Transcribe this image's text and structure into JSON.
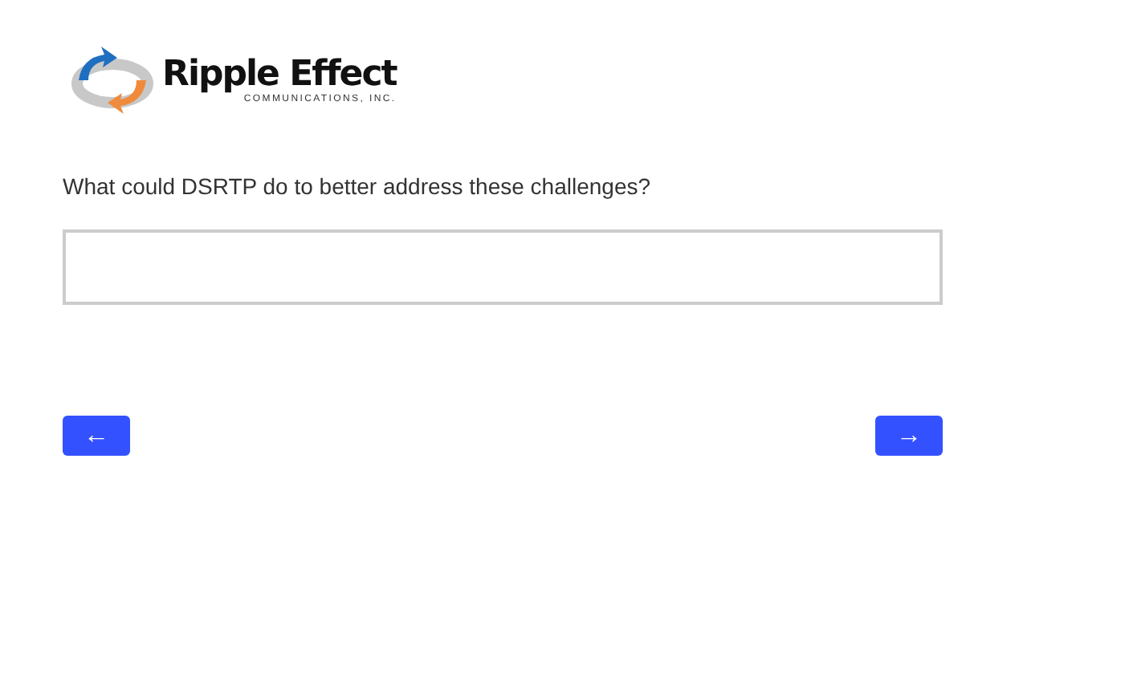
{
  "logo": {
    "name": "Ripple Effect",
    "tagline": "COMMUNICATIONS, INC."
  },
  "question": {
    "text": "What could DSRTP do to better address these challenges?"
  },
  "back_button": {
    "label": "←"
  },
  "next_button": {
    "label": "→"
  }
}
